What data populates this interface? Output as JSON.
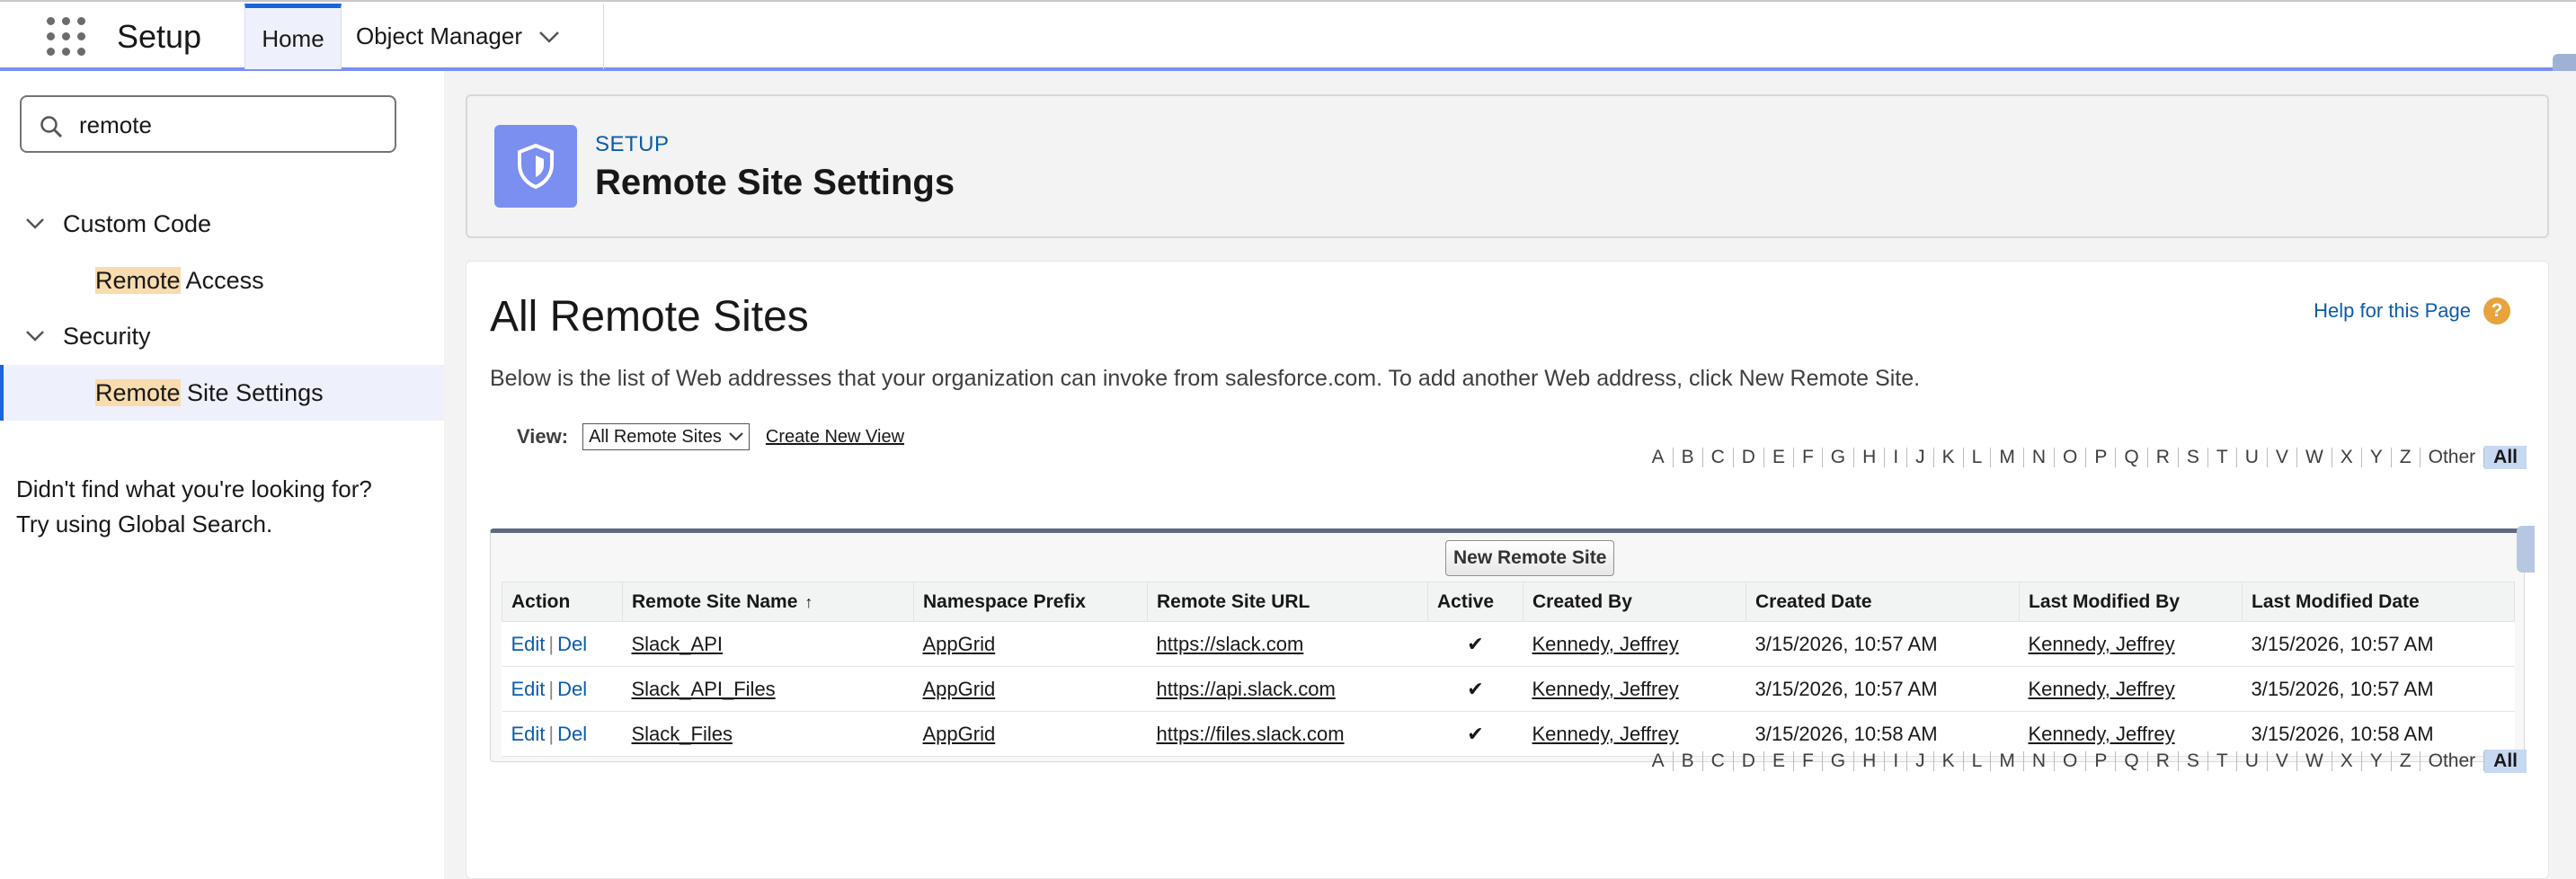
{
  "header": {
    "app_title": "Setup",
    "tabs": [
      {
        "label": "Home"
      },
      {
        "label": "Object Manager"
      }
    ]
  },
  "sidebar": {
    "search_value": "remote",
    "groups": [
      {
        "label": "Custom Code",
        "items": [
          {
            "highlight": "Remote",
            "rest": " Access"
          }
        ]
      },
      {
        "label": "Security",
        "items": [
          {
            "highlight": "Remote",
            "rest": " Site Settings"
          }
        ]
      }
    ],
    "not_found_line1": "Didn't find what you're looking for?",
    "not_found_line2": "Try using Global Search."
  },
  "page_header": {
    "eyebrow": "SETUP",
    "title": "Remote Site Settings"
  },
  "content": {
    "heading": "All Remote Sites",
    "help_link": "Help for this Page",
    "help_icon": "?",
    "description": "Below is the list of Web addresses that your organization can invoke from salesforce.com. To add another Web address, click New Remote Site.",
    "view_label": "View:",
    "view_selected": "All Remote Sites",
    "create_view": "Create New View",
    "new_button": "New Remote Site"
  },
  "alpha_filter": [
    "A",
    "B",
    "C",
    "D",
    "E",
    "F",
    "G",
    "H",
    "I",
    "J",
    "K",
    "L",
    "M",
    "N",
    "O",
    "P",
    "Q",
    "R",
    "S",
    "T",
    "U",
    "V",
    "W",
    "X",
    "Y",
    "Z",
    "Other",
    "All"
  ],
  "alpha_selected": "All",
  "table": {
    "columns": [
      "Action",
      "Remote Site Name",
      "Namespace Prefix",
      "Remote Site URL",
      "Active",
      "Created By",
      "Created Date",
      "Last Modified By",
      "Last Modified Date"
    ],
    "sort_indicator": "↑",
    "action_edit": "Edit",
    "action_sep": "|",
    "action_del": "Del",
    "active_mark": "✔",
    "rows": [
      {
        "name": "Slack_API",
        "namespace": "AppGrid",
        "url": "https://slack.com",
        "created_by": "Kennedy, Jeffrey",
        "created_date": "3/15/2026, 10:57 AM",
        "modified_by": "Kennedy, Jeffrey",
        "modified_date": "3/15/2026, 10:57 AM"
      },
      {
        "name": "Slack_API_Files",
        "namespace": "AppGrid",
        "url": "https://api.slack.com",
        "created_by": "Kennedy, Jeffrey",
        "created_date": "3/15/2026, 10:57 AM",
        "modified_by": "Kennedy, Jeffrey",
        "modified_date": "3/15/2026, 10:57 AM"
      },
      {
        "name": "Slack_Files",
        "namespace": "AppGrid",
        "url": "https://files.slack.com",
        "created_by": "Kennedy, Jeffrey",
        "created_date": "3/15/2026, 10:58 AM",
        "modified_by": "Kennedy, Jeffrey",
        "modified_date": "3/15/2026, 10:58 AM"
      }
    ]
  },
  "colors": {
    "accent": "#7b8ff0",
    "link": "#0b5cab",
    "highlight": "#f9dcae",
    "help_icon": "#e8a33d"
  }
}
